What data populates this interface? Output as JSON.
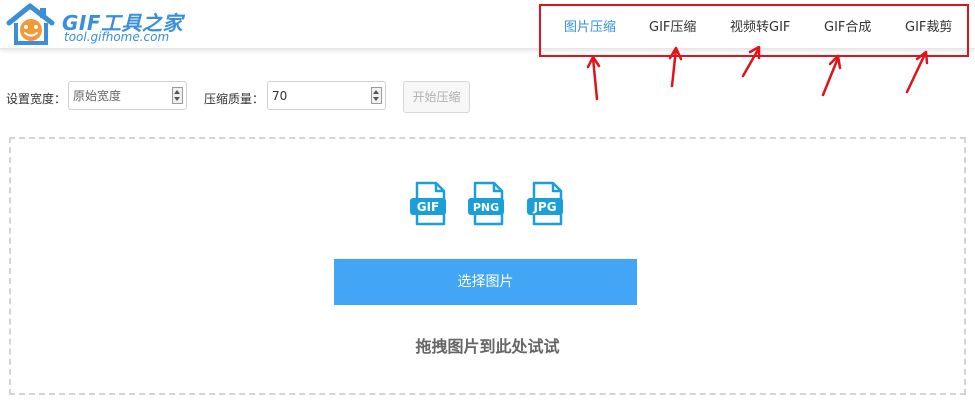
{
  "brand": {
    "title": "GIF工具之家",
    "url": "tool.gifhome.com"
  },
  "nav": {
    "items": [
      {
        "label": "图片压缩",
        "active": true
      },
      {
        "label": "GIF压缩",
        "active": false
      },
      {
        "label": "视频转GIF",
        "active": false
      },
      {
        "label": "GIF合成",
        "active": false
      },
      {
        "label": "GIF裁剪",
        "active": false
      }
    ]
  },
  "toolbar": {
    "width_label": "设置宽度：",
    "width_placeholder": "原始宽度",
    "quality_label": "压缩质量：",
    "quality_value": "70",
    "start_label": "开始压缩"
  },
  "upload": {
    "file_types": [
      "GIF",
      "PNG",
      "JPG"
    ],
    "choose_label": "选择图片",
    "drop_hint": "拖拽图片到此处试试"
  },
  "colors": {
    "accent": "#3a8fd8",
    "button": "#42a5f5",
    "file_icon": "#1a9fd9",
    "annotation": "#e0121a"
  },
  "icons": {
    "logo": "house-smiley-icon",
    "file": "file-type-icon",
    "spinner": "spinner-arrows-icon",
    "annotation": "red-arrow-icon"
  }
}
